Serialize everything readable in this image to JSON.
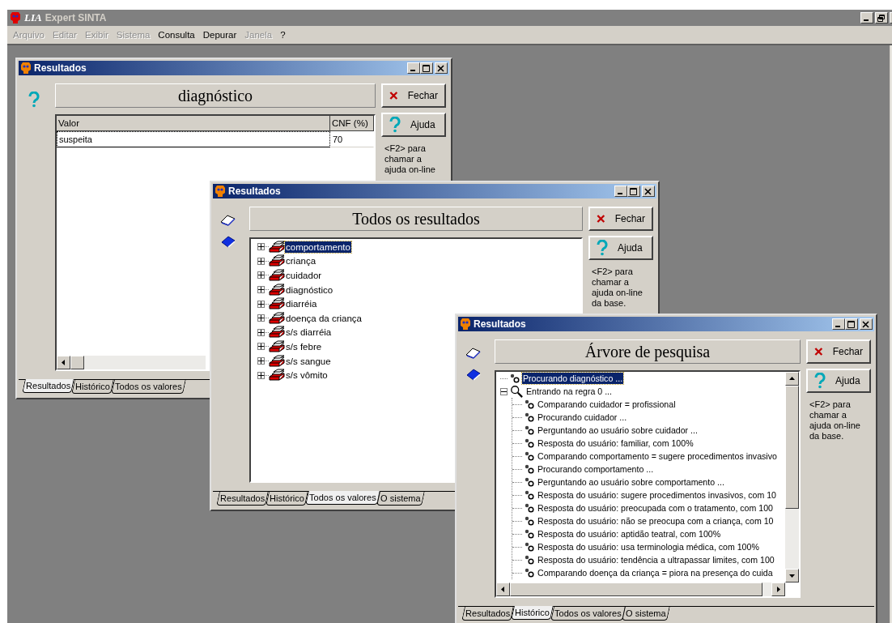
{
  "app": {
    "logo": "LIA",
    "title": "Expert SINTA"
  },
  "menu": [
    {
      "label": "Arquivo",
      "disabled": true
    },
    {
      "label": "Editar",
      "disabled": true
    },
    {
      "label": "Exibir",
      "disabled": true
    },
    {
      "label": "Sistema",
      "disabled": true
    },
    {
      "label": "Consulta",
      "disabled": false
    },
    {
      "label": "Depurar",
      "disabled": false
    },
    {
      "label": "Janela",
      "disabled": true
    },
    {
      "label": "?",
      "disabled": false
    }
  ],
  "windows": [
    {
      "kind": "grid",
      "title": "Resultados",
      "heading": "diagnóstico",
      "buttons": [
        {
          "kind": "close",
          "label": "Fechar"
        },
        {
          "kind": "help",
          "label": "Ajuda"
        }
      ],
      "hint": "<F2> para chamar a ajuda on-line",
      "columns": [
        "Valor",
        "CNF (%)"
      ],
      "rows": [
        [
          "suspeita",
          "70"
        ]
      ],
      "tabs": [
        {
          "label": "Resultados",
          "selected": true
        },
        {
          "label": "Histórico",
          "selected": false
        },
        {
          "label": "Todos os valores",
          "selected": false
        }
      ]
    },
    {
      "kind": "tree",
      "title": "Resultados",
      "heading": "Todos os resultados",
      "buttons": [
        {
          "kind": "close",
          "label": "Fechar"
        },
        {
          "kind": "help",
          "label": "Ajuda"
        }
      ],
      "hint": "<F2> para chamar a ajuda on-line da base.",
      "items": [
        {
          "label": "comportamento",
          "selected": true,
          "expanded": false
        },
        {
          "label": "criança",
          "selected": false,
          "expanded": false
        },
        {
          "label": "cuidador",
          "selected": false,
          "expanded": false
        },
        {
          "label": "diagnóstico",
          "selected": false,
          "expanded": false
        },
        {
          "label": "diarréia",
          "selected": false,
          "expanded": false
        },
        {
          "label": "doença da criança",
          "selected": false,
          "expanded": false
        },
        {
          "label": "s/s diarréia",
          "selected": false,
          "expanded": false
        },
        {
          "label": "s/s febre",
          "selected": false,
          "expanded": false
        },
        {
          "label": "s/s sangue",
          "selected": false,
          "expanded": false
        },
        {
          "label": "s/s vômito",
          "selected": false,
          "expanded": false
        }
      ],
      "tabs": [
        {
          "label": "Resultados",
          "selected": false
        },
        {
          "label": "Histórico",
          "selected": false
        },
        {
          "label": "Todos os valores",
          "selected": true
        },
        {
          "label": "O sistema",
          "selected": false
        }
      ]
    },
    {
      "kind": "trace",
      "title": "Resultados",
      "heading": "Árvore de pesquisa",
      "buttons": [
        {
          "kind": "close",
          "label": "Fechar"
        },
        {
          "kind": "help",
          "label": "Ajuda"
        }
      ],
      "hint": "<F2> para chamar a ajuda on-line da base.",
      "items": [
        {
          "kind": "step",
          "label": "Procurando diagnóstico ...",
          "selected": true
        },
        {
          "kind": "rule",
          "label": "Entrando na regra 0 ...",
          "selected": false,
          "expanded": true,
          "children": [
            {
              "kind": "step",
              "label": "Comparando cuidador = profissional",
              "selected": false
            },
            {
              "kind": "step",
              "label": "Procurando cuidador ...",
              "selected": false
            },
            {
              "kind": "step",
              "label": "Perguntando ao usuário sobre cuidador ...",
              "selected": false
            },
            {
              "kind": "step",
              "label": "Resposta do usuário: familiar, com 100%",
              "selected": false
            },
            {
              "kind": "step",
              "label": "Comparando comportamento = sugere procedimentos invasivo",
              "selected": false
            },
            {
              "kind": "step",
              "label": "Procurando comportamento ...",
              "selected": false
            },
            {
              "kind": "step",
              "label": "Perguntando ao usuário sobre comportamento ...",
              "selected": false
            },
            {
              "kind": "step",
              "label": "Resposta do usuário: sugere procedimentos invasivos, com 10",
              "selected": false
            },
            {
              "kind": "step",
              "label": "Resposta do usuário: preocupada com o tratamento, com 100",
              "selected": false
            },
            {
              "kind": "step",
              "label": "Resposta do usuário: não se preocupa com a criança, com 10",
              "selected": false
            },
            {
              "kind": "step",
              "label": "Resposta do usuário: aptidão teatral, com 100%",
              "selected": false
            },
            {
              "kind": "step",
              "label": "Resposta do usuário: usa terminologia médica, com 100%",
              "selected": false
            },
            {
              "kind": "step",
              "label": "Resposta do usuário: tendência a ultrapassar limites, com 100",
              "selected": false
            },
            {
              "kind": "step",
              "label": "Comparando doença da criança = piora na presença do cuida",
              "selected": false
            }
          ]
        }
      ],
      "tabs": [
        {
          "label": "Resultados",
          "selected": false
        },
        {
          "label": "Histórico",
          "selected": true
        },
        {
          "label": "Todos os valores",
          "selected": false
        },
        {
          "label": "O sistema",
          "selected": false
        }
      ]
    }
  ]
}
